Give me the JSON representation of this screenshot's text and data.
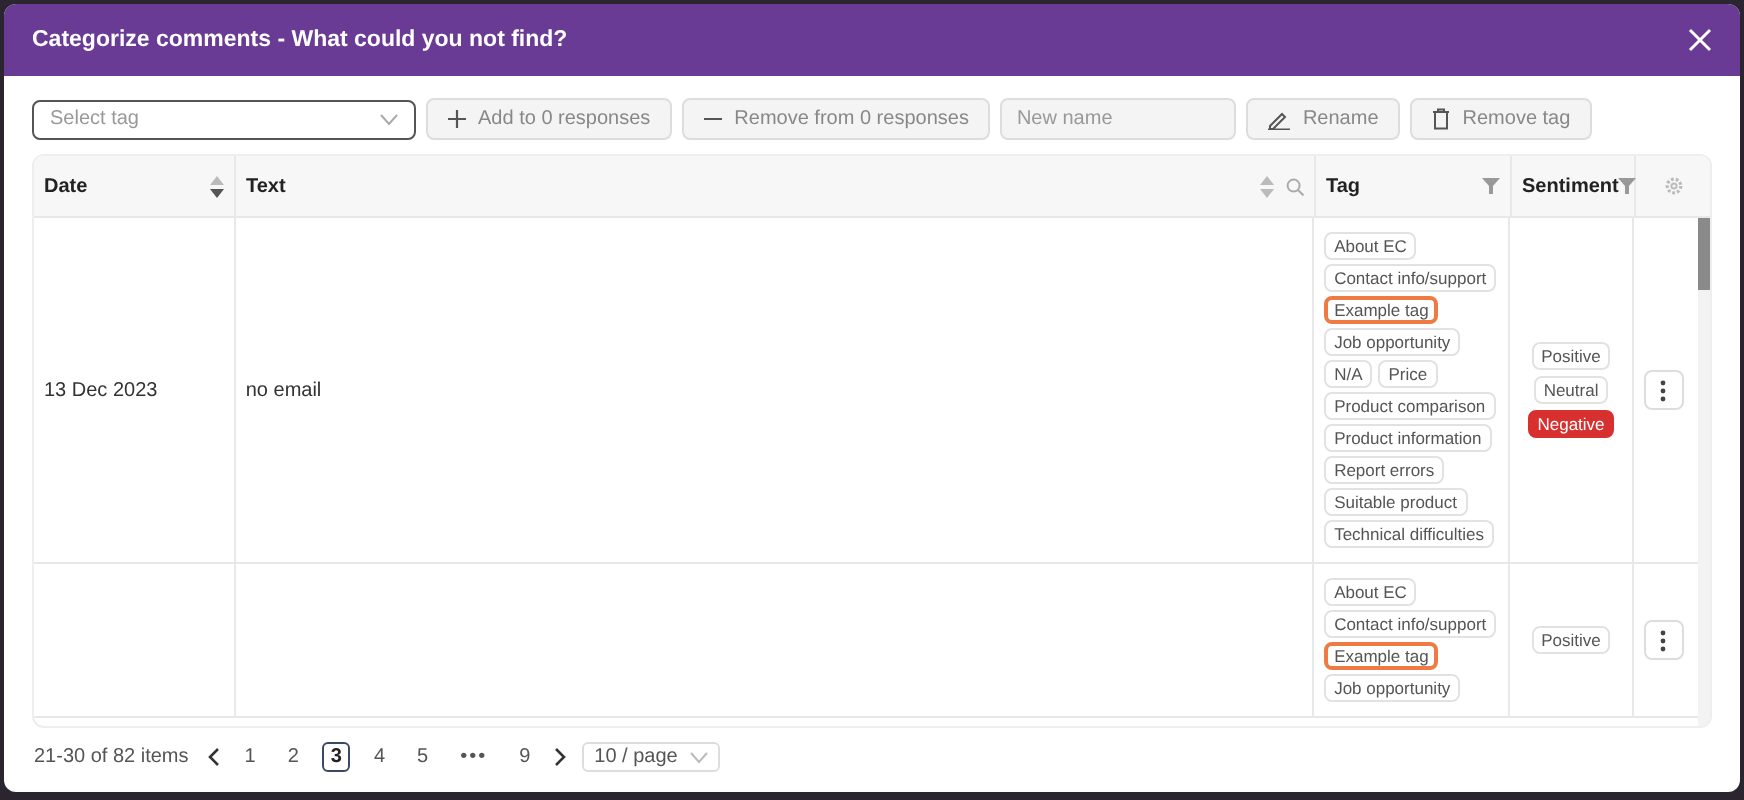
{
  "dialog": {
    "title": "Categorize comments - What could you not find?"
  },
  "toolbar": {
    "tag_select": {
      "placeholder": "Select tag"
    },
    "add_button": "Add to 0 responses",
    "remove_button": "Remove from 0 responses",
    "name_field": {
      "placeholder": "New name"
    },
    "rename_button": "Rename",
    "remove_tag_button": "Remove tag"
  },
  "table": {
    "columns": [
      {
        "label": "Date",
        "kind": "sort"
      },
      {
        "label": "Text",
        "kind": "sort_search"
      },
      {
        "label": "Tag",
        "kind": "filter"
      },
      {
        "label": "Sentiment",
        "kind": "filter"
      }
    ],
    "rows": [
      {
        "date": "13 Dec 2023",
        "text": "no email",
        "tags": [
          {
            "label": "About EC",
            "selected": false
          },
          {
            "label": "Contact info/support",
            "selected": false
          },
          {
            "label": "Example tag",
            "selected": true
          },
          {
            "label": "Job opportunity",
            "selected": false
          },
          {
            "label": "N/A",
            "selected": false
          },
          {
            "label": "Price",
            "selected": false
          },
          {
            "label": "Product comparison",
            "selected": false
          },
          {
            "label": "Product information",
            "selected": false
          },
          {
            "label": "Report errors",
            "selected": false
          },
          {
            "label": "Suitable product",
            "selected": false
          },
          {
            "label": "Technical difficulties",
            "selected": false
          }
        ],
        "sentiments": [
          {
            "label": "Positive",
            "selected": false
          },
          {
            "label": "Neutral",
            "selected": false
          },
          {
            "label": "Negative",
            "selected": true
          }
        ]
      },
      {
        "tags": [
          {
            "label": "About EC",
            "selected": false
          },
          {
            "label": "Contact info/support",
            "selected": false
          },
          {
            "label": "Example tag",
            "selected": true
          },
          {
            "label": "Job opportunity",
            "selected": false
          }
        ],
        "sentiments": [
          {
            "label": "Positive",
            "selected": false
          }
        ]
      }
    ]
  },
  "pagination": {
    "summary": "21-30 of 82 items",
    "pages": [
      {
        "kind": "page",
        "label": "1",
        "selected": false
      },
      {
        "kind": "page",
        "label": "2",
        "selected": false
      },
      {
        "kind": "page",
        "label": "3",
        "selected": true
      },
      {
        "kind": "page",
        "label": "4",
        "selected": false
      },
      {
        "kind": "page",
        "label": "5",
        "selected": false
      },
      {
        "kind": "jump",
        "label": "•••",
        "selected": false
      },
      {
        "kind": "page",
        "label": "9",
        "selected": false
      }
    ],
    "page_size": "10 / page"
  }
}
